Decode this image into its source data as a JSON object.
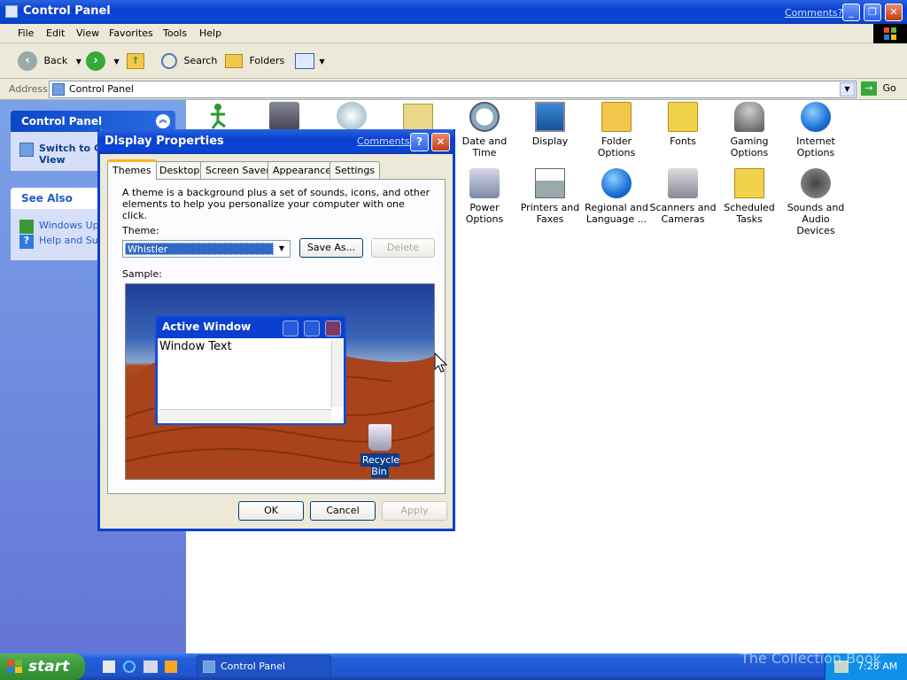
{
  "window": {
    "title": "Control Panel",
    "comments_link": "Comments?"
  },
  "menu": [
    "File",
    "Edit",
    "View",
    "Favorites",
    "Tools",
    "Help"
  ],
  "toolbar": {
    "back": "Back",
    "search": "Search",
    "folders": "Folders"
  },
  "address": {
    "label": "Address",
    "value": "Control Panel",
    "go": "Go"
  },
  "left_panel": {
    "control_panel_title": "Control Panel",
    "switch_view": "Switch to Category View",
    "see_also_title": "See Also",
    "see_also_links": [
      "Windows Update",
      "Help and Support"
    ]
  },
  "cp_items": [
    {
      "label": "Date and Time",
      "icon": "clock-icon"
    },
    {
      "label": "Display",
      "icon": "display-icon"
    },
    {
      "label": "Folder Options",
      "icon": "folder-icon"
    },
    {
      "label": "Fonts",
      "icon": "fonts-folder-icon"
    },
    {
      "label": "Gaming Options",
      "icon": "joystick-icon"
    },
    {
      "label": "Internet Options",
      "icon": "globe-icon"
    },
    {
      "label": "Power Options",
      "icon": "power-icon"
    },
    {
      "label": "Printers and Faxes",
      "icon": "printer-icon"
    },
    {
      "label": "Regional and Language ...",
      "icon": "globe-icon"
    },
    {
      "label": "Scanners and Cameras",
      "icon": "scanner-icon"
    },
    {
      "label": "Scheduled Tasks",
      "icon": "scheduled-tasks-icon"
    },
    {
      "label": "Sounds and Audio Devices",
      "icon": "speaker-icon"
    }
  ],
  "dialog": {
    "title": "Display Properties",
    "comments": "Comments?",
    "tabs": [
      "Themes",
      "Desktop",
      "Screen Saver",
      "Appearance",
      "Settings"
    ],
    "description": "A theme is a background plus a set of sounds, icons, and other elements to help you personalize your computer with one click.",
    "theme_label": "Theme:",
    "theme_value": "Whistler",
    "save_as": "Save As...",
    "delete": "Delete",
    "sample_label": "Sample:",
    "sample_window_title": "Active Window",
    "sample_window_text": "Window Text",
    "recycle_bin": "Recycle Bin",
    "ok": "OK",
    "cancel": "Cancel",
    "apply": "Apply"
  },
  "taskbar": {
    "start": "start",
    "task_item": "Control Panel",
    "clock": "7:28 AM",
    "watermark": "The Collection Book"
  }
}
